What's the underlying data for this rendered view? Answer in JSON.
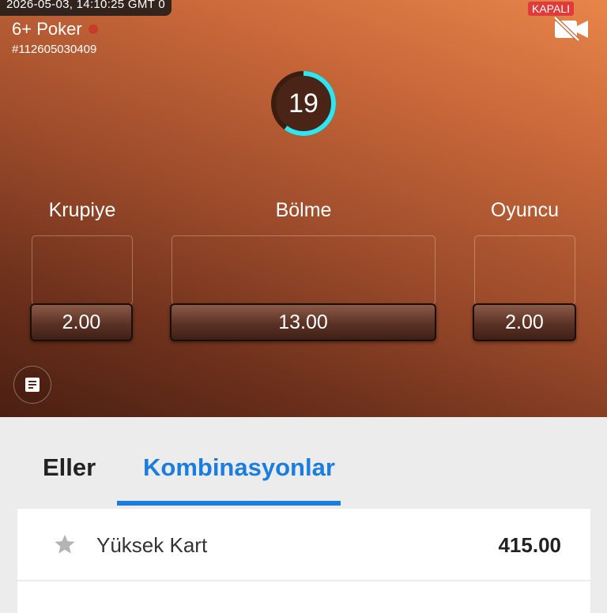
{
  "header": {
    "timestamp": "2026-05-03, 14:10:25 GMT 0",
    "title": "6+ Poker",
    "round_id": "#112605030409",
    "camera_status": "KAPALI"
  },
  "timer": {
    "seconds": "19",
    "progress": 0.6
  },
  "bets": [
    {
      "label": "Krupiye",
      "odds": "2.00"
    },
    {
      "label": "Bölme",
      "odds": "13.00"
    },
    {
      "label": "Oyuncu",
      "odds": "2.00"
    }
  ],
  "tabs": [
    {
      "label": "Eller",
      "active": false
    },
    {
      "label": "Kombinasyonlar",
      "active": true
    }
  ],
  "combinations": [
    {
      "name": "Yüksek Kart",
      "value": "415.00"
    }
  ],
  "colors": {
    "accent": "#1a7de0",
    "timer_ring": "#2ee6f0",
    "live_dot": "#c83a2a",
    "closed_badge": "#e03a3a"
  }
}
